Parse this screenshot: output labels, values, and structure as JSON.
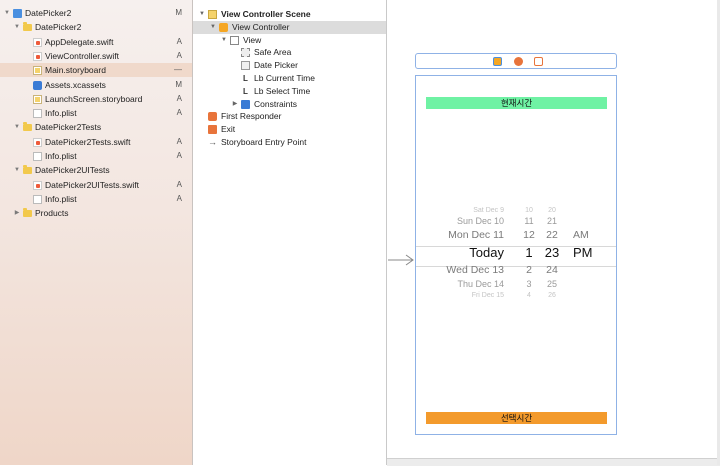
{
  "navigator": {
    "items": [
      {
        "label": "DatePicker2",
        "status": "M",
        "icon": "project-icon",
        "level": 0,
        "disclosure": "open"
      },
      {
        "label": "DatePicker2",
        "status": "",
        "icon": "folder-icon",
        "level": 1,
        "disclosure": "open"
      },
      {
        "label": "AppDelegate.swift",
        "status": "A",
        "icon": "swift-file-icon",
        "level": 2,
        "disclosure": ""
      },
      {
        "label": "ViewController.swift",
        "status": "A",
        "icon": "swift-file-icon",
        "level": 2,
        "disclosure": ""
      },
      {
        "label": "Main.storyboard",
        "status": "—",
        "icon": "storyboard-file-icon",
        "level": 2,
        "disclosure": "",
        "selected": true
      },
      {
        "label": "Assets.xcassets",
        "status": "M",
        "icon": "asset-catalog-icon",
        "level": 2,
        "disclosure": ""
      },
      {
        "label": "LaunchScreen.storyboard",
        "status": "A",
        "icon": "storyboard-file-icon",
        "level": 2,
        "disclosure": ""
      },
      {
        "label": "Info.plist",
        "status": "A",
        "icon": "plist-file-icon",
        "level": 2,
        "disclosure": ""
      },
      {
        "label": "DatePicker2Tests",
        "status": "",
        "icon": "folder-icon",
        "level": 1,
        "disclosure": "open"
      },
      {
        "label": "DatePicker2Tests.swift",
        "status": "A",
        "icon": "swift-file-icon",
        "level": 2,
        "disclosure": ""
      },
      {
        "label": "Info.plist",
        "status": "A",
        "icon": "plist-file-icon",
        "level": 2,
        "disclosure": ""
      },
      {
        "label": "DatePicker2UITests",
        "status": "",
        "icon": "folder-icon",
        "level": 1,
        "disclosure": "open"
      },
      {
        "label": "DatePicker2UITests.swift",
        "status": "A",
        "icon": "swift-file-icon",
        "level": 2,
        "disclosure": ""
      },
      {
        "label": "Info.plist",
        "status": "A",
        "icon": "plist-file-icon",
        "level": 2,
        "disclosure": ""
      },
      {
        "label": "Products",
        "status": "",
        "icon": "folder-icon",
        "level": 1,
        "disclosure": "closed"
      }
    ]
  },
  "outline": {
    "items": [
      {
        "label": "View Controller Scene",
        "icon": "scene-icon",
        "level": 0,
        "disclosure": "open",
        "bold": true
      },
      {
        "label": "View Controller",
        "icon": "view-controller-icon",
        "level": 1,
        "disclosure": "open",
        "selected": true
      },
      {
        "label": "View",
        "icon": "view-icon",
        "level": 2,
        "disclosure": "open"
      },
      {
        "label": "Safe Area",
        "icon": "safe-area-icon",
        "level": 3,
        "disclosure": ""
      },
      {
        "label": "Date Picker",
        "icon": "date-picker-icon",
        "level": 3,
        "disclosure": ""
      },
      {
        "label": "Lb Current Time",
        "icon": "label-icon",
        "level": 3,
        "disclosure": ""
      },
      {
        "label": "Lb Select Time",
        "icon": "label-icon",
        "level": 3,
        "disclosure": ""
      },
      {
        "label": "Constraints",
        "icon": "constraints-icon",
        "level": 3,
        "disclosure": "closed"
      },
      {
        "label": "First Responder",
        "icon": "first-responder-icon",
        "level": 0,
        "disclosure": ""
      },
      {
        "label": "Exit",
        "icon": "exit-icon",
        "level": 0,
        "disclosure": ""
      },
      {
        "label": "Storyboard Entry Point",
        "icon": "entry-arrow-icon",
        "level": 0,
        "disclosure": ""
      }
    ]
  },
  "canvas": {
    "current_time_label": "현재시간",
    "select_time_label": "선택시간",
    "label_colors": {
      "current": "#6ff2a4",
      "select": "#f39a2c"
    },
    "picker_rows": [
      {
        "date": "Sat Dec 9",
        "hour": "10",
        "minute": "20",
        "ampm": "",
        "style": "edge"
      },
      {
        "date": "Sun Dec 10",
        "hour": "11",
        "minute": "21",
        "ampm": "",
        "style": "near"
      },
      {
        "date": "Mon Dec 11",
        "hour": "12",
        "minute": "22",
        "ampm": "AM",
        "style": "adjacent"
      },
      {
        "date": "Today",
        "hour": "1",
        "minute": "23",
        "ampm": "PM",
        "style": "selected"
      },
      {
        "date": "Wed Dec 13",
        "hour": "2",
        "minute": "24",
        "ampm": "",
        "style": "adjacent"
      },
      {
        "date": "Thu Dec 14",
        "hour": "3",
        "minute": "25",
        "ampm": "",
        "style": "near"
      },
      {
        "date": "Fri Dec 15",
        "hour": "4",
        "minute": "26",
        "ampm": "",
        "style": "edge"
      }
    ]
  }
}
